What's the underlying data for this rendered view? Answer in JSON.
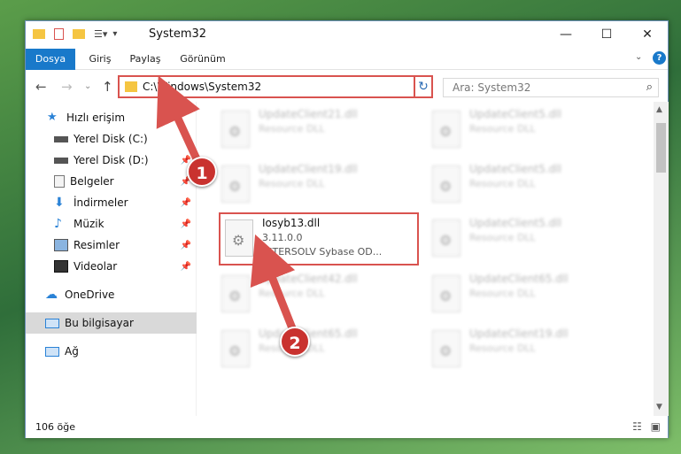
{
  "window": {
    "title": "System32"
  },
  "ribbon": {
    "tabs": [
      {
        "label": "Dosya",
        "active": true
      },
      {
        "label": "Giriş",
        "active": false
      },
      {
        "label": "Paylaş",
        "active": false
      },
      {
        "label": "Görünüm",
        "active": false
      }
    ]
  },
  "address": {
    "path": "C:\\Windows\\System32",
    "search_placeholder": "Ara: System32"
  },
  "sidebar": {
    "items": [
      {
        "label": "Hızlı erişim",
        "icon": "star-icon"
      },
      {
        "label": "Yerel Disk (C:)",
        "icon": "drive-icon"
      },
      {
        "label": "Yerel Disk (D:)",
        "icon": "drive-icon"
      },
      {
        "label": "Belgeler",
        "icon": "documents-icon"
      },
      {
        "label": "İndirmeler",
        "icon": "download-icon"
      },
      {
        "label": "Müzik",
        "icon": "music-icon"
      },
      {
        "label": "Resimler",
        "icon": "pictures-icon"
      },
      {
        "label": "Videolar",
        "icon": "video-icon"
      },
      {
        "label": "OneDrive",
        "icon": "cloud-icon"
      },
      {
        "label": "Bu bilgisayar",
        "icon": "computer-icon"
      },
      {
        "label": "Ağ",
        "icon": "network-icon"
      }
    ]
  },
  "files": [
    {
      "name": "UpdateClient21.dll",
      "desc": "Resource DLL"
    },
    {
      "name": "UpdateClient5.dll",
      "desc": "Resource DLL"
    },
    {
      "name": "UpdateClient19.dll",
      "desc": "Resource DLL"
    },
    {
      "name": "UpdateClient5.dll",
      "desc": "Resource DLL"
    },
    {
      "name": "UpdateClient5.dll",
      "desc": "Resource DLL"
    },
    {
      "name": "UpdateClient42.dll",
      "desc": "Resource DLL"
    },
    {
      "name": "UpdateClient65.dll",
      "desc": "Resource DLL"
    },
    {
      "name": "UpdateClient65.dll",
      "desc": "Resource DLL"
    },
    {
      "name": "UpdateClient19.dll",
      "desc": "Resource DLL"
    }
  ],
  "focus_file": {
    "name": "Iosyb13.dll",
    "version": "3.11.0.0",
    "desc": "INTERSOLV Sybase OD..."
  },
  "status": {
    "count": "106 öğe"
  },
  "annotations": {
    "step1": "1",
    "step2": "2"
  },
  "colors": {
    "accent": "#1979ca",
    "highlight": "#d9534f"
  }
}
